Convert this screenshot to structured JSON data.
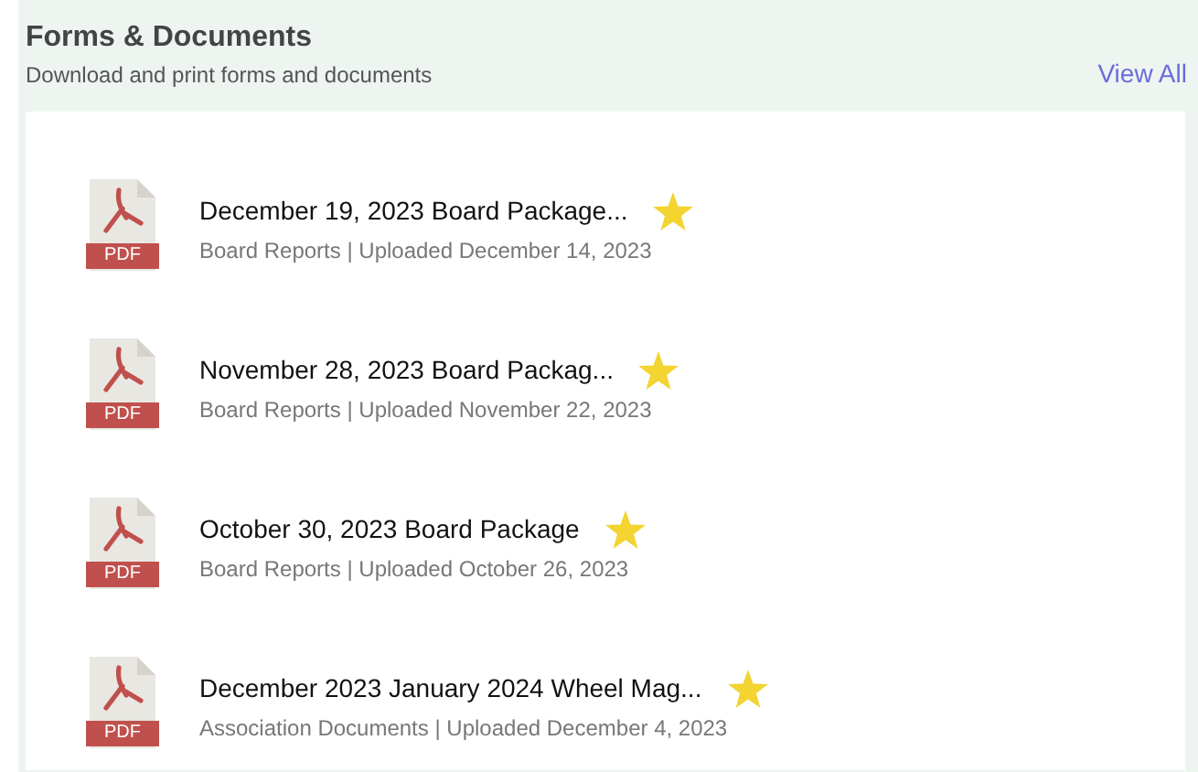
{
  "header": {
    "title": "Forms & Documents",
    "subtitle": "Download and print forms and documents",
    "link": "View All"
  },
  "documents": [
    {
      "file_type": "PDF",
      "title": "December 19, 2023 Board Package...",
      "meta": "Board Reports | Uploaded December 14, 2023",
      "starred": true
    },
    {
      "file_type": "PDF",
      "title": "November 28, 2023 Board Packag...",
      "meta": "Board Reports | Uploaded November 22, 2023",
      "starred": true
    },
    {
      "file_type": "PDF",
      "title": "October 30, 2023 Board Package",
      "meta": "Board Reports | Uploaded October 26, 2023",
      "starred": true
    },
    {
      "file_type": "PDF",
      "title": "December 2023 January 2024 Wheel Mag...",
      "meta": "Association Documents | Uploaded December 4, 2023",
      "starred": true
    }
  ]
}
